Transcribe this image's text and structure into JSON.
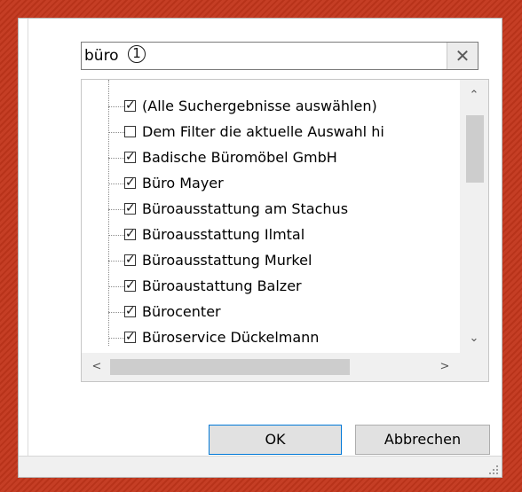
{
  "search": {
    "value": "büro",
    "callout": "1",
    "clear_glyph": "✕"
  },
  "list": {
    "items": [
      {
        "label": "(Alle Suchergebnisse auswählen)",
        "checked": true
      },
      {
        "label": "Dem Filter die aktuelle Auswahl hi",
        "checked": false
      },
      {
        "label": "Badische Büromöbel GmbH",
        "checked": true
      },
      {
        "label": "Büro Mayer",
        "checked": true
      },
      {
        "label": "Büroausstattung am Stachus",
        "checked": true
      },
      {
        "label": "Büroausstattung Ilmtal",
        "checked": true
      },
      {
        "label": "Büroausstattung Murkel",
        "checked": true
      },
      {
        "label": "Büroaustattung Balzer",
        "checked": true
      },
      {
        "label": "Bürocenter",
        "checked": true
      },
      {
        "label": "Büroservice Dückelmann",
        "checked": true
      }
    ]
  },
  "scroll": {
    "up": "⌃",
    "down": "⌄",
    "left": "<",
    "right": ">"
  },
  "buttons": {
    "ok": "OK",
    "cancel": "Abbrechen"
  },
  "colors": {
    "background": "#c3361c",
    "ok_border": "#0078d7"
  }
}
